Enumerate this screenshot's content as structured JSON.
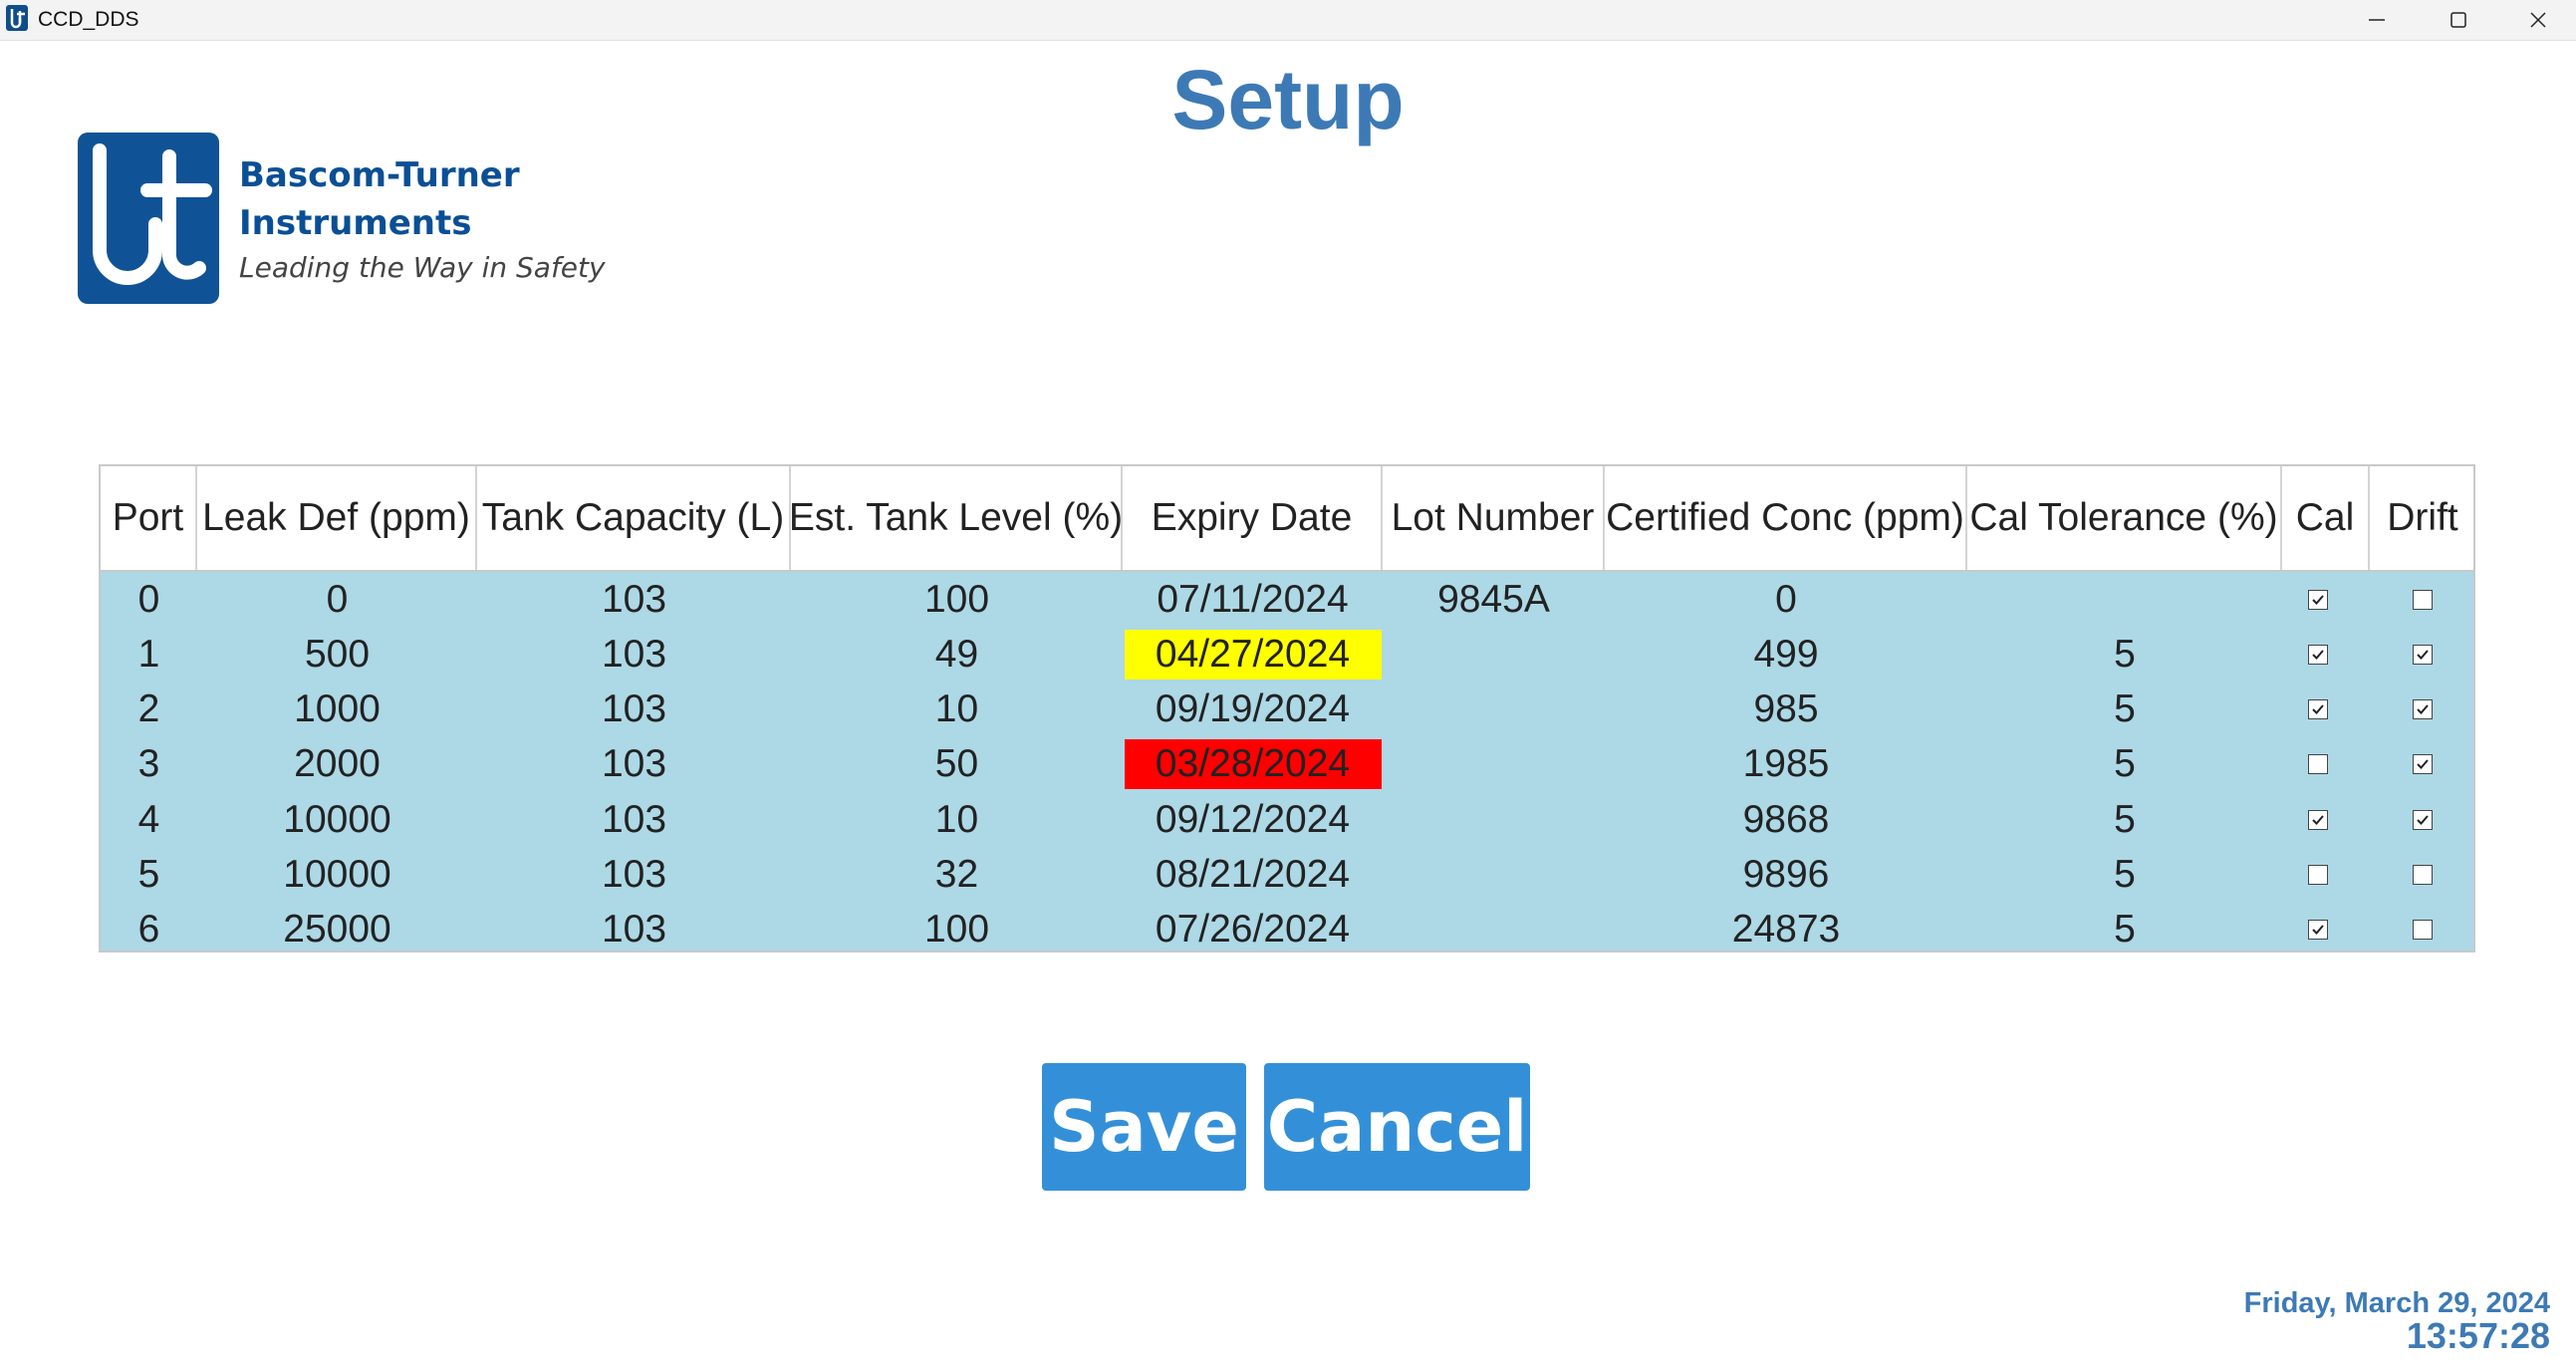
{
  "window": {
    "title": "CCD_DDS"
  },
  "page": {
    "title": "Setup"
  },
  "brand": {
    "name_line1": "Bascom-Turner",
    "name_line2": "Instruments",
    "tagline": "Leading the Way in Safety"
  },
  "table": {
    "columns": [
      "Port",
      "Leak Def (ppm)",
      "Tank Capacity (L)",
      "Est. Tank Level (%)",
      "Expiry Date",
      "Lot Number",
      "Certified Conc (ppm)",
      "Cal Tolerance (%)",
      "Cal",
      "Drift"
    ],
    "rows": [
      {
        "port": "0",
        "leak_def": "0",
        "tank_capacity": "103",
        "tank_level": "100",
        "expiry": "07/11/2024",
        "expiry_status": "ok",
        "lot": "9845A",
        "certified": "0",
        "tolerance": "",
        "cal": true,
        "drift": false
      },
      {
        "port": "1",
        "leak_def": "500",
        "tank_capacity": "103",
        "tank_level": "49",
        "expiry": "04/27/2024",
        "expiry_status": "warning",
        "lot": "",
        "certified": "499",
        "tolerance": "5",
        "cal": true,
        "drift": true
      },
      {
        "port": "2",
        "leak_def": "1000",
        "tank_capacity": "103",
        "tank_level": "10",
        "expiry": "09/19/2024",
        "expiry_status": "ok",
        "lot": "",
        "certified": "985",
        "tolerance": "5",
        "cal": true,
        "drift": true
      },
      {
        "port": "3",
        "leak_def": "2000",
        "tank_capacity": "103",
        "tank_level": "50",
        "expiry": "03/28/2024",
        "expiry_status": "expired",
        "lot": "",
        "certified": "1985",
        "tolerance": "5",
        "cal": false,
        "drift": true
      },
      {
        "port": "4",
        "leak_def": "10000",
        "tank_capacity": "103",
        "tank_level": "10",
        "expiry": "09/12/2024",
        "expiry_status": "ok",
        "lot": "",
        "certified": "9868",
        "tolerance": "5",
        "cal": true,
        "drift": true
      },
      {
        "port": "5",
        "leak_def": "10000",
        "tank_capacity": "103",
        "tank_level": "32",
        "expiry": "08/21/2024",
        "expiry_status": "ok",
        "lot": "",
        "certified": "9896",
        "tolerance": "5",
        "cal": false,
        "drift": false
      },
      {
        "port": "6",
        "leak_def": "25000",
        "tank_capacity": "103",
        "tank_level": "100",
        "expiry": "07/26/2024",
        "expiry_status": "ok",
        "lot": "",
        "certified": "24873",
        "tolerance": "5",
        "cal": true,
        "drift": false
      }
    ]
  },
  "buttons": {
    "save": "Save",
    "cancel": "Cancel"
  },
  "status": {
    "date": "Friday, March 29, 2024",
    "time": "13:57:28"
  },
  "colors": {
    "title": "#3d7ab5",
    "row_background": "#add8e6",
    "expiry_warning": "#ffff00",
    "expiry_expired": "#ff0000",
    "button": "#3390d8",
    "brand": "#0a4f96"
  },
  "icons": [
    "app-icon",
    "minimize-icon",
    "maximize-icon",
    "close-icon",
    "checkbox-checked",
    "checkbox-empty"
  ]
}
